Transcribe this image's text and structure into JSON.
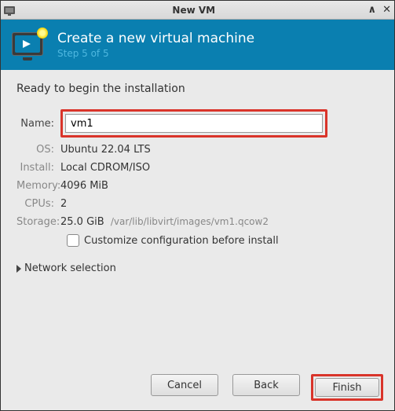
{
  "window": {
    "title": "New VM"
  },
  "header": {
    "title": "Create a new virtual machine",
    "step": "Step 5 of 5"
  },
  "content": {
    "ready": "Ready to begin the installation",
    "labels": {
      "name": "Name:",
      "os": "OS:",
      "install": "Install:",
      "memory": "Memory:",
      "cpus": "CPUs:",
      "storage": "Storage:"
    },
    "values": {
      "name": "vm1",
      "os": "Ubuntu 22.04 LTS",
      "install": "Local CDROM/ISO",
      "memory": "4096 MiB",
      "cpus": "2",
      "storage_size": "25.0 GiB",
      "storage_path": "/var/lib/libvirt/images/vm1.qcow2"
    },
    "customize_label": "Customize configuration before install",
    "network_selection": "Network selection"
  },
  "footer": {
    "cancel": "Cancel",
    "back": "Back",
    "finish": "Finish"
  }
}
